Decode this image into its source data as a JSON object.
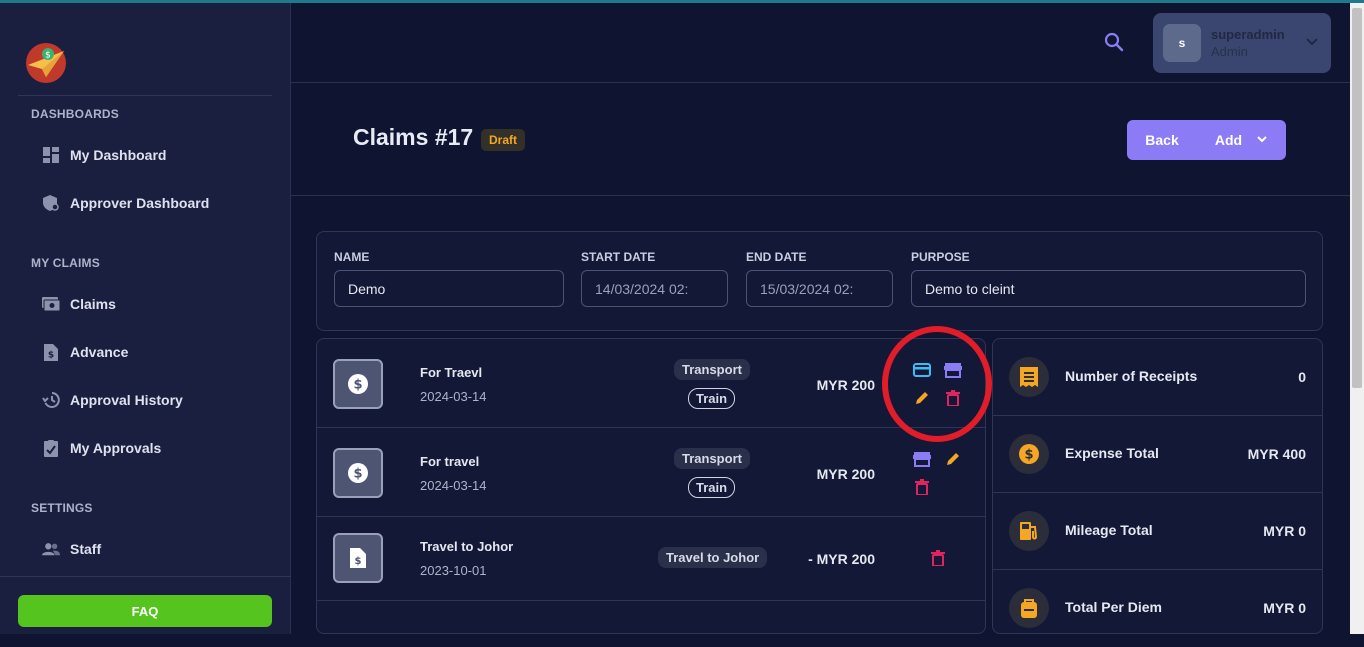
{
  "sidebar": {
    "sections": [
      "DASHBOARDS",
      "MY CLAIMS",
      "SETTINGS"
    ],
    "items": [
      {
        "label": "My Dashboard",
        "icon": "dashboard-icon"
      },
      {
        "label": "Approver Dashboard",
        "icon": "shield-icon"
      },
      {
        "label": "Claims",
        "icon": "money-icon"
      },
      {
        "label": "Advance",
        "icon": "document-dollar-icon"
      },
      {
        "label": "Approval History",
        "icon": "history-icon"
      },
      {
        "label": "My Approvals",
        "icon": "checklist-icon"
      },
      {
        "label": "Staff",
        "icon": "people-icon"
      }
    ],
    "faq_label": "FAQ"
  },
  "header": {
    "user": {
      "initial": "s",
      "name": "superadmin",
      "role": "Admin"
    }
  },
  "page": {
    "title": "Claims #17",
    "status_badge": "Draft",
    "back_label": "Back",
    "add_label": "Add"
  },
  "form": {
    "name_label": "NAME",
    "name_value": "Demo",
    "start_label": "START DATE",
    "start_value": "14/03/2024 02:",
    "end_label": "END DATE",
    "end_value": "15/03/2024 02:",
    "purpose_label": "PURPOSE",
    "purpose_value": "Demo to cleint"
  },
  "claims": [
    {
      "title": "For Traevl",
      "date": "2024-03-14",
      "category": "Transport",
      "subcategory": "Train",
      "amount": "MYR 200"
    },
    {
      "title": "For travel",
      "date": "2024-03-14",
      "category": "Transport",
      "subcategory": "Train",
      "amount": "MYR 200"
    },
    {
      "title": "Travel to Johor",
      "date": "2023-10-01",
      "category": "Travel to Johor",
      "amount": "- MYR 200"
    }
  ],
  "summary": [
    {
      "label": "Number of Receipts",
      "value": "0",
      "icon": "receipt-icon"
    },
    {
      "label": "Expense Total",
      "value": "MYR 400",
      "icon": "dollar-icon"
    },
    {
      "label": "Mileage Total",
      "value": "MYR 0",
      "icon": "fuel-icon"
    },
    {
      "label": "Total Per Diem",
      "value": "MYR 0",
      "icon": "backpack-icon"
    }
  ],
  "colors": {
    "accent": "#8b7cf6",
    "faq": "#56c41f",
    "draft": "#f5a623",
    "delete": "#e0245e",
    "edit": "#f5a623",
    "card": "#38bdf8",
    "annotation": "#e11d2a"
  }
}
